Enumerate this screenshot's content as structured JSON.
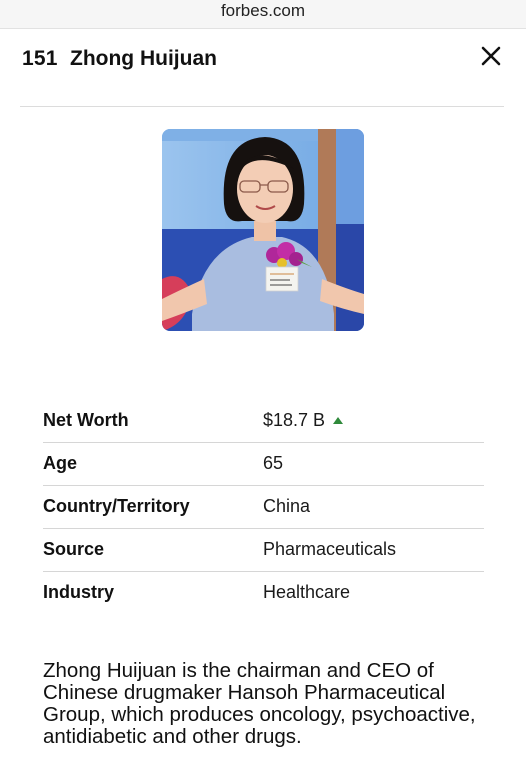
{
  "browser": {
    "domain": "forbes.com"
  },
  "header": {
    "rank": "151",
    "name": "Zhong Huijuan"
  },
  "details": [
    {
      "label": "Net Worth",
      "value": "$18.7 B",
      "trend": "up"
    },
    {
      "label": "Age",
      "value": "65"
    },
    {
      "label": "Country/Territory",
      "value": "China"
    },
    {
      "label": "Source",
      "value": "Pharmaceuticals"
    },
    {
      "label": "Industry",
      "value": "Healthcare"
    }
  ],
  "bio": "Zhong Huijuan is the chairman and CEO of Chinese drugmaker Hansoh Pharmaceutical Group, which produces oncology, psychoactive, antidiabetic and other drugs.",
  "colors": {
    "trend_up": "#2f8a3b",
    "orchid": "#b0279a",
    "dress": "#a9bde0"
  }
}
